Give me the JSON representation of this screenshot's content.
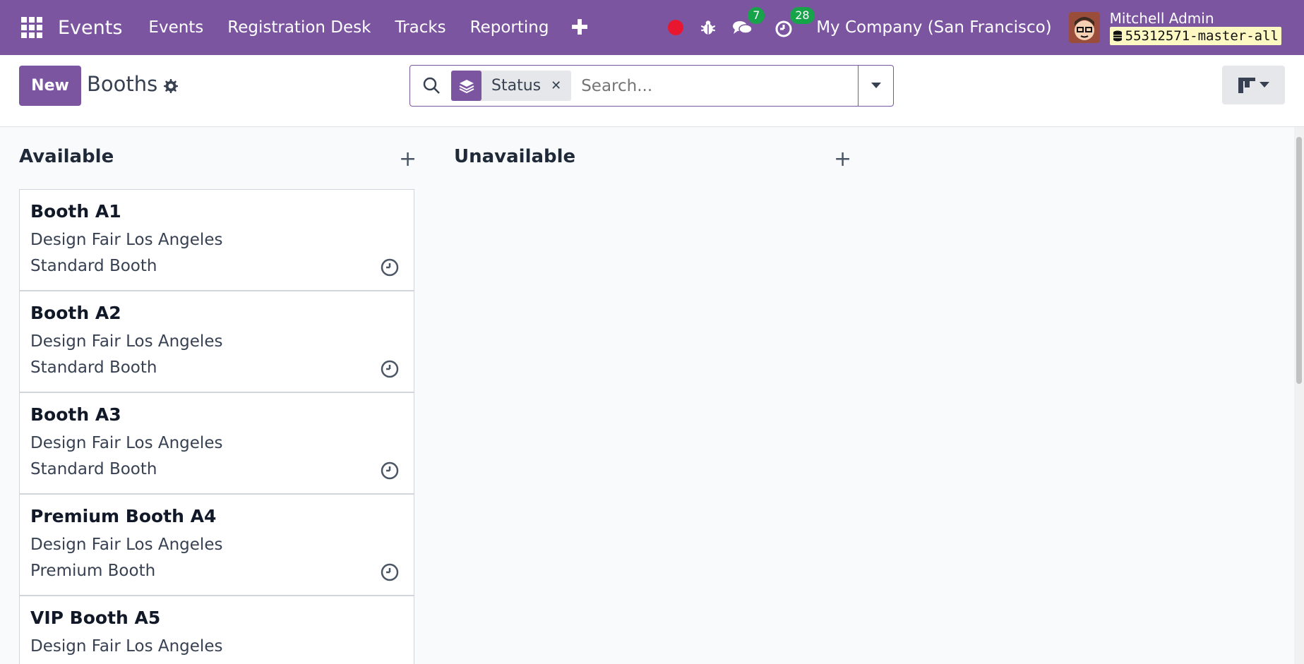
{
  "navbar": {
    "brand": "Events",
    "menu": [
      "Events",
      "Registration Desk",
      "Tracks",
      "Reporting"
    ],
    "messages_count": "7",
    "activities_count": "28",
    "company": "My Company (San Francisco)",
    "user_name": "Mitchell Admin",
    "database": "55312571-master-all",
    "accent_color": "#7c55a0"
  },
  "control": {
    "new_label": "New",
    "title": "Booths",
    "search": {
      "facet_label": "Status",
      "placeholder": "Search..."
    }
  },
  "kanban": {
    "columns": [
      {
        "title": "Available",
        "cards": [
          {
            "name": "Booth A1",
            "event": "Design Fair Los Angeles",
            "type": "Standard Booth"
          },
          {
            "name": "Booth A2",
            "event": "Design Fair Los Angeles",
            "type": "Standard Booth"
          },
          {
            "name": "Booth A3",
            "event": "Design Fair Los Angeles",
            "type": "Standard Booth"
          },
          {
            "name": "Premium Booth A4",
            "event": "Design Fair Los Angeles",
            "type": "Premium Booth"
          },
          {
            "name": "VIP Booth A5",
            "event": "Design Fair Los Angeles",
            "type": ""
          }
        ]
      },
      {
        "title": "Unavailable",
        "cards": []
      }
    ]
  }
}
